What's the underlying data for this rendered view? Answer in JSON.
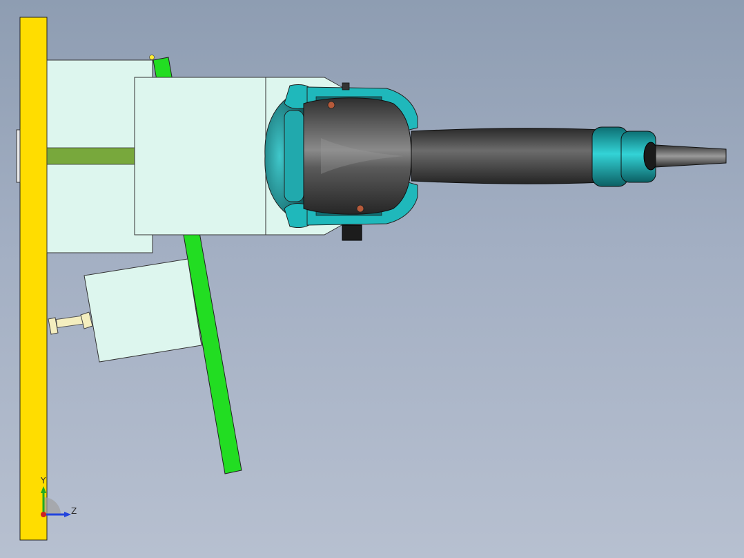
{
  "viewport": {
    "background_top": "#8e9db2",
    "background_bottom": "#b7c0d0"
  },
  "triad": {
    "y_label": "Y",
    "z_label": "Z",
    "y_color": "#22aa22",
    "z_color": "#2244dd",
    "x_color": "#cc2222"
  },
  "colors": {
    "base_plate": "#ffdd00",
    "block": "#ddf6ee",
    "slot": "#78a83c",
    "bar": "#22dd22",
    "body_dark": "#4a4a4a",
    "teal": "#1fb8bb",
    "bolt": "#f4eebf"
  }
}
